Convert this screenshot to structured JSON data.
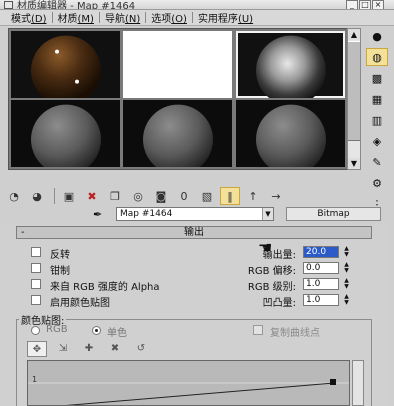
{
  "window": {
    "title": "材质编辑器 - Map #1464",
    "controls": [
      "_",
      "□",
      "×"
    ]
  },
  "menu": [
    {
      "label": "模式",
      "hotkey": "(D)"
    },
    {
      "label": "材质",
      "hotkey": "(M)"
    },
    {
      "label": "导航",
      "hotkey": "(N)"
    },
    {
      "label": "选项",
      "hotkey": "(O)"
    },
    {
      "label": "实用程序",
      "hotkey": "(U)"
    }
  ],
  "slots": [
    {
      "kind": "dark-brown-glossy"
    },
    {
      "kind": "white-flat"
    },
    {
      "kind": "photo-texture"
    },
    {
      "kind": "gray-default"
    },
    {
      "kind": "gray-default"
    },
    {
      "kind": "gray-default"
    }
  ],
  "right_tools": [
    "sample-type-icon",
    "backlight-icon",
    "checker-background-icon",
    "sample-uv-tiling-icon",
    "video-color-check-icon",
    "make-preview-icon",
    "options-icon",
    "select-by-material-icon",
    "material-map-navigator-icon"
  ],
  "horizontal_tools": [
    "get-material-icon",
    "put-to-scene-icon",
    "assign-to-selection-icon",
    "reset-map-icon",
    "copy-material-icon",
    "make-unique-icon",
    "put-to-library-icon",
    "material-id-channel-icon",
    "show-map-in-viewport-icon",
    "show-end-result-icon",
    "go-to-parent-icon",
    "go-forward-to-sibling-icon"
  ],
  "name_row": {
    "map_name": "Map #1464",
    "map_type": "Bitmap"
  },
  "rollout": {
    "title": "输出",
    "collapse_symbol": "-"
  },
  "options": [
    {
      "label": "反转",
      "checked": false
    },
    {
      "label": "钳制",
      "checked": false
    },
    {
      "label": "来自 RGB 强度的 Alpha",
      "checked": false
    },
    {
      "label": "启用颜色贴图",
      "checked": false
    }
  ],
  "fields": [
    {
      "label": "输出量:",
      "value": "20.0"
    },
    {
      "label": "RGB 偏移:",
      "value": "0.0"
    },
    {
      "label": "RGB 级别:",
      "value": "1.0"
    },
    {
      "label": "凹凸量:",
      "value": "1.0"
    }
  ],
  "color_map": {
    "group_label": "颜色贴图:",
    "modes": [
      {
        "label": "RGB",
        "selected": false
      },
      {
        "label": "单色",
        "selected": true
      }
    ],
    "copy_curve_points_label": "复制曲线点",
    "curve_tools": [
      "move-icon",
      "scale-point-icon",
      "add-point-icon",
      "delete-point-icon",
      "reset-curves-icon"
    ],
    "axis_marker": "1"
  },
  "colors": {
    "selection_highlight": "#2a5bc9",
    "toggle_active": "#f3e19a",
    "panel_bg": "#d0d0d0"
  }
}
